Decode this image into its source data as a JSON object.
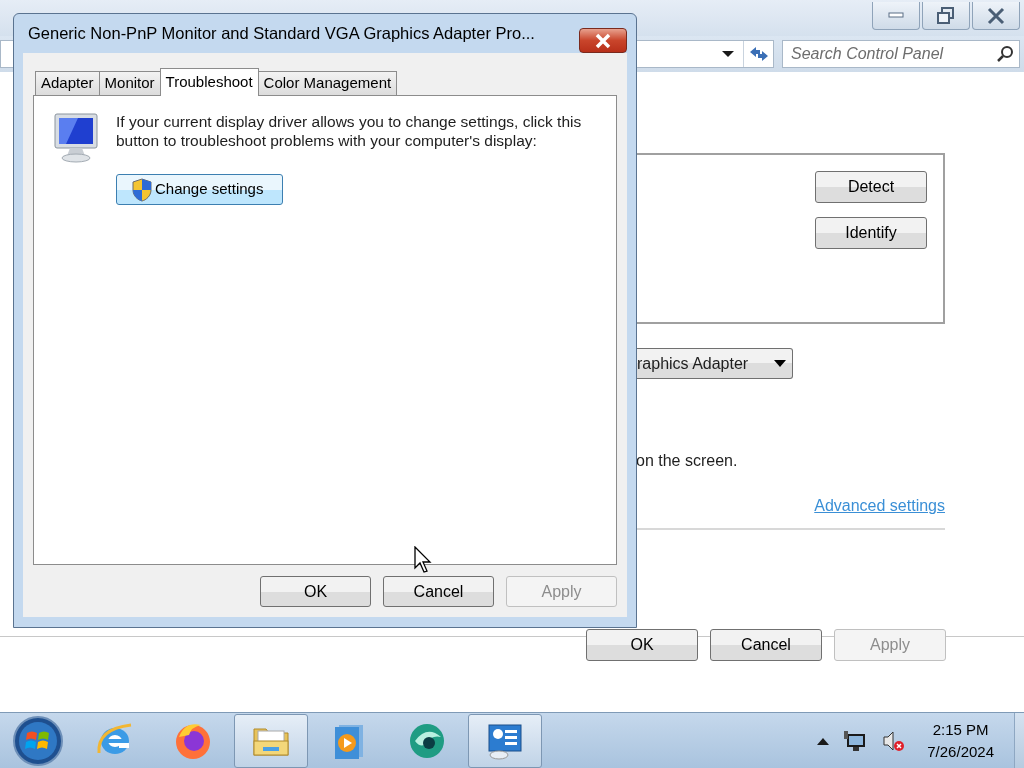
{
  "background_window": {
    "caption_buttons": [
      {
        "kind": "minimize"
      },
      {
        "kind": "restore"
      },
      {
        "kind": "close"
      }
    ],
    "search": {
      "placeholder": "Search Control Panel"
    },
    "monitor_buttons": [
      {
        "label": "Detect"
      },
      {
        "label": "Identify"
      }
    ],
    "adapter_dropdown": {
      "value": "raphics Adapter"
    },
    "note": "on the screen.",
    "link": "Advanced settings",
    "buttons": [
      {
        "label": "OK",
        "disabled": false
      },
      {
        "label": "Cancel",
        "disabled": false
      },
      {
        "label": "Apply",
        "disabled": true
      }
    ]
  },
  "dialog": {
    "title": "Generic Non-PnP Monitor and Standard VGA Graphics Adapter Pro...",
    "tabs": [
      {
        "label": "Adapter",
        "selected": false
      },
      {
        "label": "Monitor",
        "selected": false
      },
      {
        "label": "Troubleshoot",
        "selected": true
      },
      {
        "label": "Color Management",
        "selected": false
      }
    ],
    "message": "If your current display driver allows you to change settings, click this button to troubleshoot problems with your computer's display:",
    "action_button": "Change settings",
    "buttons": [
      {
        "label": "OK",
        "disabled": false
      },
      {
        "label": "Cancel",
        "disabled": false
      },
      {
        "label": "Apply",
        "disabled": true
      }
    ]
  },
  "taskbar": {
    "apps": [
      {
        "kind": "ie",
        "active": false
      },
      {
        "kind": "firefox",
        "active": false
      },
      {
        "kind": "explorer",
        "active": true
      },
      {
        "kind": "media",
        "active": false
      },
      {
        "kind": "green",
        "active": false
      },
      {
        "kind": "display",
        "active": true
      }
    ],
    "clock": {
      "time": "2:15 PM",
      "date": "7/26/2024"
    }
  }
}
